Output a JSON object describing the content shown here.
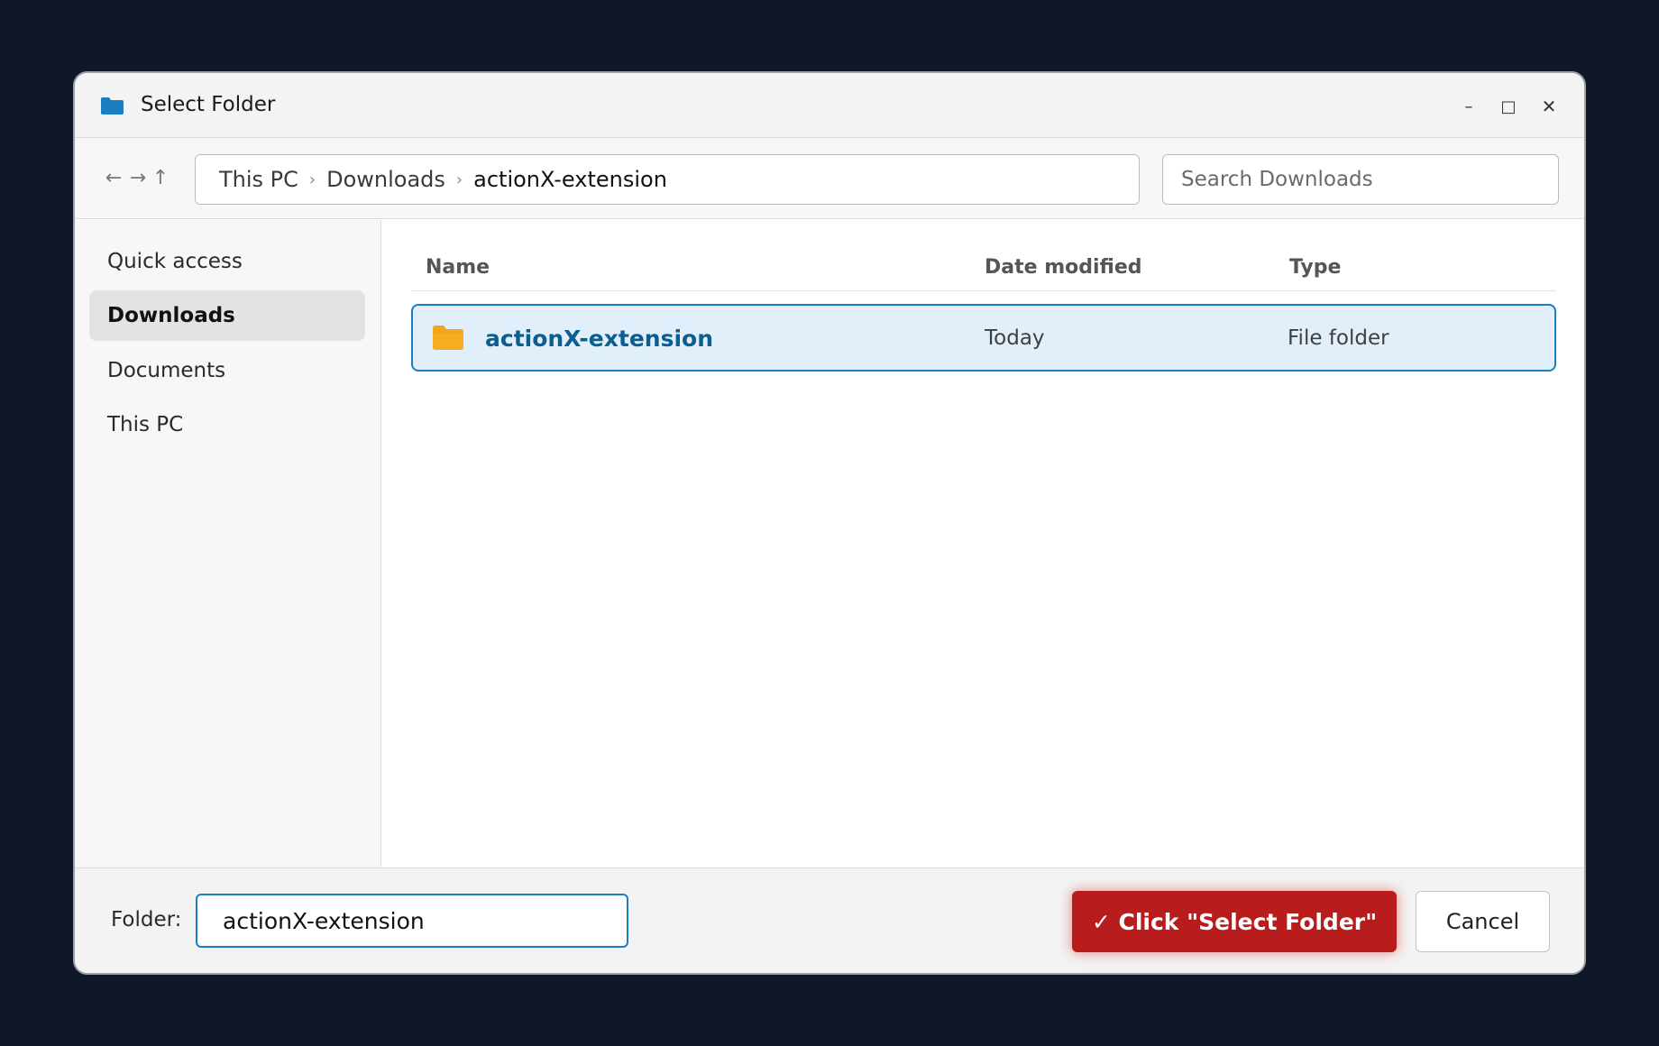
{
  "window": {
    "title": "Select Folder",
    "title_icon": "folder-icon",
    "controls": {
      "minimize": "–",
      "maximize": "□",
      "close": "✕"
    }
  },
  "toolbar": {
    "nav": {
      "back": "←",
      "forward": "→",
      "up": "↑"
    },
    "breadcrumb": [
      "This PC",
      "Downloads",
      "actionX-extension"
    ],
    "breadcrumb_separator": "›",
    "search_placeholder": "Search Downloads"
  },
  "sidebar": {
    "items": [
      {
        "label": "Quick access",
        "active": false
      },
      {
        "label": "Downloads",
        "active": true
      },
      {
        "label": "Documents",
        "active": false
      },
      {
        "label": "This PC",
        "active": false
      }
    ]
  },
  "list": {
    "columns": {
      "name": "Name",
      "date": "Date modified",
      "type": "Type"
    },
    "rows": [
      {
        "name": "actionX-extension",
        "date": "Today",
        "type": "File folder",
        "icon": "folder-icon",
        "selected": true
      }
    ]
  },
  "footer": {
    "folder_label": "Folder:",
    "folder_value": "actionX-extension",
    "select_label": "✓ Click \"Select Folder\"",
    "cancel_label": "Cancel"
  },
  "colors": {
    "background": "#0f1729",
    "accent": "#1a7ec1",
    "primary_button": "#b91c1c",
    "folder_yellow": "#f4a51c",
    "title_folder_blue": "#1a7ec1"
  }
}
